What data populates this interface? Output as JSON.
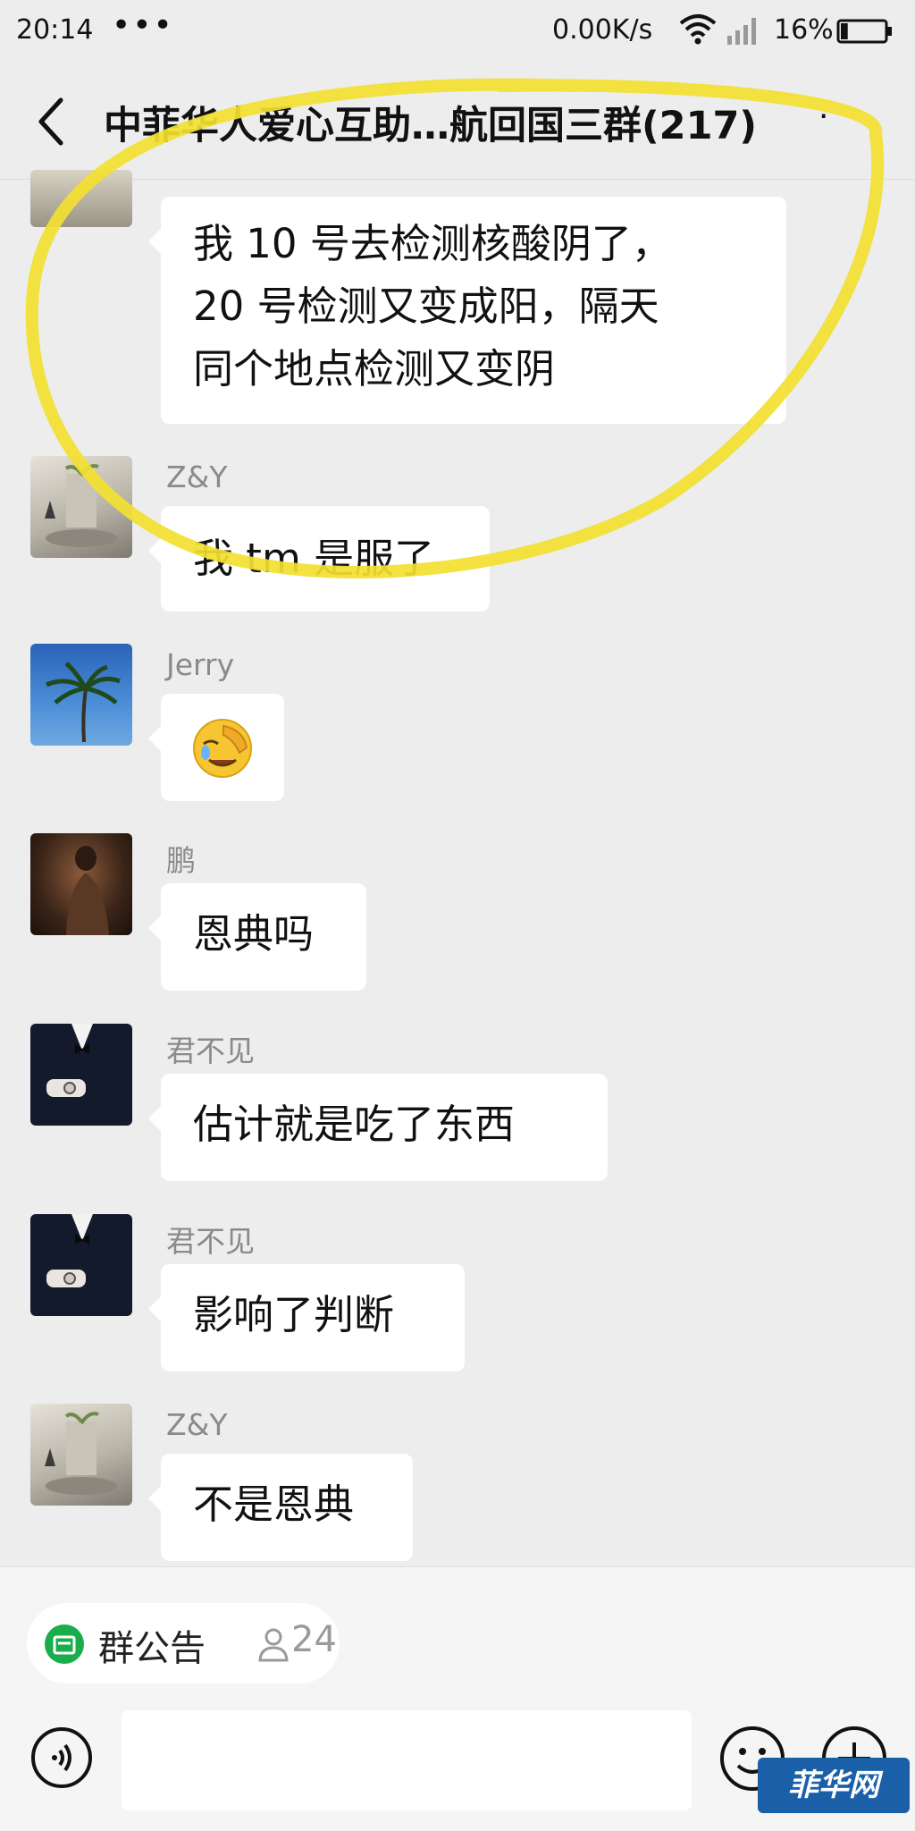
{
  "status_bar": {
    "time": "20:14",
    "dots": "•••",
    "network_speed": "0.00K/s",
    "battery_percent": "16%",
    "battery_level": 0.16,
    "icons": [
      "wifi-icon",
      "signal-icon",
      "battery-icon"
    ]
  },
  "header": {
    "title": "中菲华人爱心互助…航回国三群(217)",
    "more_label": "·",
    "icons": [
      "back-arrow-icon"
    ]
  },
  "messages": [
    {
      "sender": "",
      "lines": [
        "我 10 号去检测核酸阴了，",
        "20 号检测又变成阳，隔天",
        "同个地点检测又变阴"
      ]
    },
    {
      "sender": "Z&Y",
      "lines": [
        "我 tm 是服了"
      ]
    },
    {
      "sender": "Jerry",
      "lines": [
        "🤦"
      ],
      "emoji_icon": "facepalm-emoji-icon"
    },
    {
      "sender": "鹏",
      "lines": [
        "恩典吗"
      ]
    },
    {
      "sender": "君不见",
      "lines": [
        "估计就是吃了东西"
      ]
    },
    {
      "sender": "君不见",
      "lines": [
        "影响了判断"
      ]
    },
    {
      "sender": "Z&Y",
      "lines": [
        "不是恩典"
      ]
    }
  ],
  "bottom": {
    "notice_label": "群公告",
    "notice_count": "24",
    "icons": [
      "notice-icon",
      "person-icon",
      "voice-icon",
      "emoji-icon",
      "plus-icon"
    ]
  },
  "watermark": "菲华网",
  "colors": {
    "background": "#ededed",
    "bubble": "#ffffff",
    "marker": "#f2e030",
    "notice_green": "#1aad4c",
    "watermark_blue": "#1a5fa8"
  }
}
